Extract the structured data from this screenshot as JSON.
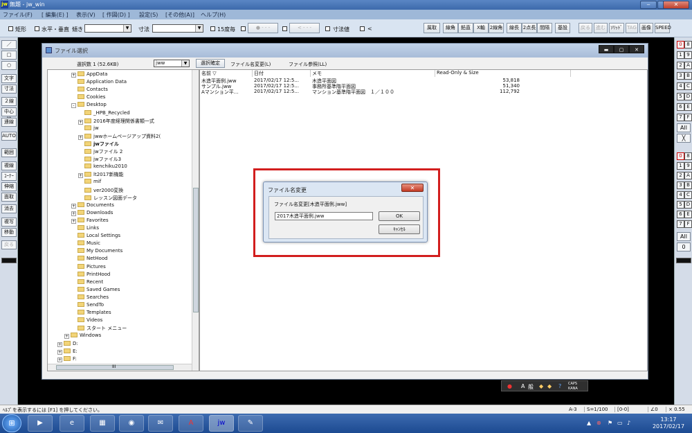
{
  "window": {
    "title": "無題 - jw_win",
    "app_icon": "jw",
    "min": "‒",
    "max": "❐",
    "close": "✕"
  },
  "menu": [
    "ファイル(F)",
    "[ 編集(E) ]",
    "表示(V)",
    "[ 作図(D) ]",
    "設定(S)",
    "[その他(A)]",
    "ヘルプ(H)"
  ],
  "toolbar": {
    "rect": "矩形",
    "horiz": "水平・垂直",
    "tilt": "傾き",
    "dim": "寸法",
    "deg15": "15度毎",
    "dimval": "寸法値",
    "lt": "<",
    "buttons": [
      "属取",
      "線角",
      "鉛直",
      "X軸",
      "2線角",
      "線長",
      "2点長",
      "間隔",
      "基設"
    ],
    "buttons_disabled": [
      "戻る",
      "進む",
      "ｿﾘｯﾄﾞ",
      "TAG",
      "画像",
      "SPEED"
    ]
  },
  "left_tools": [
    "／",
    "□",
    "○",
    "文字",
    "寸法",
    "２線",
    "中心線",
    "連線",
    "AUTO",
    "範囲",
    "複線",
    "ｺｰﾅｰ",
    "伸縮",
    "面取",
    "消去",
    "複写",
    "移動",
    "戻る"
  ],
  "right_layers": {
    "row1": [
      "0",
      "8",
      "1",
      "9",
      "2",
      "A",
      "3",
      "B",
      "4",
      "C",
      "5",
      "D",
      "6",
      "E",
      "7",
      "F"
    ],
    "all": "All",
    "group_row": [
      "0",
      "8",
      "1",
      "9",
      "2",
      "A",
      "3",
      "B",
      "4",
      "C",
      "5",
      "D",
      "6",
      "E",
      "7",
      "F"
    ],
    "all2": "All",
    "zero": "0"
  },
  "file_dialog": {
    "title": "ファイル選択",
    "selected_count": "選択数 1 (52.6KB)",
    "type": "jww",
    "btn_confirm": "選択確定",
    "btn_rename": "ファイル名変更(L)",
    "btn_browse": "ファイル参照(LL)",
    "tree": [
      {
        "label": "AppData",
        "indent": 2,
        "pm": "+"
      },
      {
        "label": "Application Data",
        "indent": 2,
        "pm": ""
      },
      {
        "label": "Contacts",
        "indent": 2,
        "pm": ""
      },
      {
        "label": "Cookies",
        "indent": 2,
        "pm": ""
      },
      {
        "label": "Desktop",
        "indent": 2,
        "pm": "-"
      },
      {
        "label": "_HPB_Recycled",
        "indent": 3,
        "pm": ""
      },
      {
        "label": "2016年度経理関係書類一式",
        "indent": 3,
        "pm": "+"
      },
      {
        "label": "jw",
        "indent": 3,
        "pm": ""
      },
      {
        "label": "jwwホームページアップ資料2(",
        "indent": 3,
        "pm": "+"
      },
      {
        "label": "jwファイル",
        "indent": 3,
        "pm": "",
        "bold": true
      },
      {
        "label": "jwファイル 2",
        "indent": 3,
        "pm": ""
      },
      {
        "label": "jwファイル3",
        "indent": 3,
        "pm": ""
      },
      {
        "label": "kenchiku2010",
        "indent": 3,
        "pm": ""
      },
      {
        "label": "lt2017新機能",
        "indent": 3,
        "pm": "+"
      },
      {
        "label": "mif",
        "indent": 3,
        "pm": ""
      },
      {
        "label": "ver2000変換",
        "indent": 3,
        "pm": ""
      },
      {
        "label": "レッスン図面データ",
        "indent": 3,
        "pm": ""
      },
      {
        "label": "Documents",
        "indent": 2,
        "pm": "+"
      },
      {
        "label": "Downloads",
        "indent": 2,
        "pm": "+"
      },
      {
        "label": "Favorites",
        "indent": 2,
        "pm": "+"
      },
      {
        "label": "Links",
        "indent": 2,
        "pm": ""
      },
      {
        "label": "Local Settings",
        "indent": 2,
        "pm": ""
      },
      {
        "label": "Music",
        "indent": 2,
        "pm": ""
      },
      {
        "label": "My Documents",
        "indent": 2,
        "pm": ""
      },
      {
        "label": "NetHood",
        "indent": 2,
        "pm": ""
      },
      {
        "label": "Pictures",
        "indent": 2,
        "pm": ""
      },
      {
        "label": "PrintHood",
        "indent": 2,
        "pm": ""
      },
      {
        "label": "Recent",
        "indent": 2,
        "pm": ""
      },
      {
        "label": "Saved Games",
        "indent": 2,
        "pm": ""
      },
      {
        "label": "Searches",
        "indent": 2,
        "pm": ""
      },
      {
        "label": "SendTo",
        "indent": 2,
        "pm": ""
      },
      {
        "label": "Templates",
        "indent": 2,
        "pm": ""
      },
      {
        "label": "Videos",
        "indent": 2,
        "pm": ""
      },
      {
        "label": "スタート メニュー",
        "indent": 2,
        "pm": ""
      },
      {
        "label": "Windows",
        "indent": 1,
        "pm": "+"
      },
      {
        "label": "D:",
        "indent": 0,
        "pm": "+"
      },
      {
        "label": "E:",
        "indent": 0,
        "pm": "+"
      },
      {
        "label": "F:",
        "indent": 0,
        "pm": "+"
      }
    ],
    "hscroll_label": "III",
    "columns": [
      "名前 ▽",
      "日付",
      "メモ",
      "Read-Only & Size"
    ],
    "files": [
      {
        "name": "木造平面例.jww",
        "date": "2017/02/17  12:5...",
        "memo": "木造平面図",
        "size": "53,818"
      },
      {
        "name": "サンプル.jww",
        "date": "2017/02/17  12:5...",
        "memo": "事務所基準階平面図",
        "size": "51,340"
      },
      {
        "name": "Aマンション平...",
        "date": "2017/02/17  12:5...",
        "memo": "マンション基準階平面図　１／１００",
        "size": "112,792"
      }
    ]
  },
  "rename_dialog": {
    "title": "ファイル名変更",
    "label": "ファイル名変更[木造平面例.jww]",
    "value": "2017木造平面例.jww",
    "ok": "OK",
    "cancel": "ｷｬﾝｾﾙ",
    "close": "✕"
  },
  "ime": {
    "a": "A",
    "mode": "般",
    "caps": "CAPS",
    "kana": "KANA"
  },
  "status": {
    "help": "ﾍﾙﾌﾟを表示するには [F1] を押してください。",
    "paper": "A-3",
    "scale": "S=1/100",
    "layer": "[0-0]",
    "angle": "∠0",
    "factor": "× 0.55"
  },
  "taskbar": {
    "time": "13:17",
    "date": "2017/02/17",
    "apps": [
      "folder",
      "ie",
      "explorer",
      "chrome",
      "thunderbird",
      "acrobat",
      "jww",
      "paint"
    ]
  }
}
